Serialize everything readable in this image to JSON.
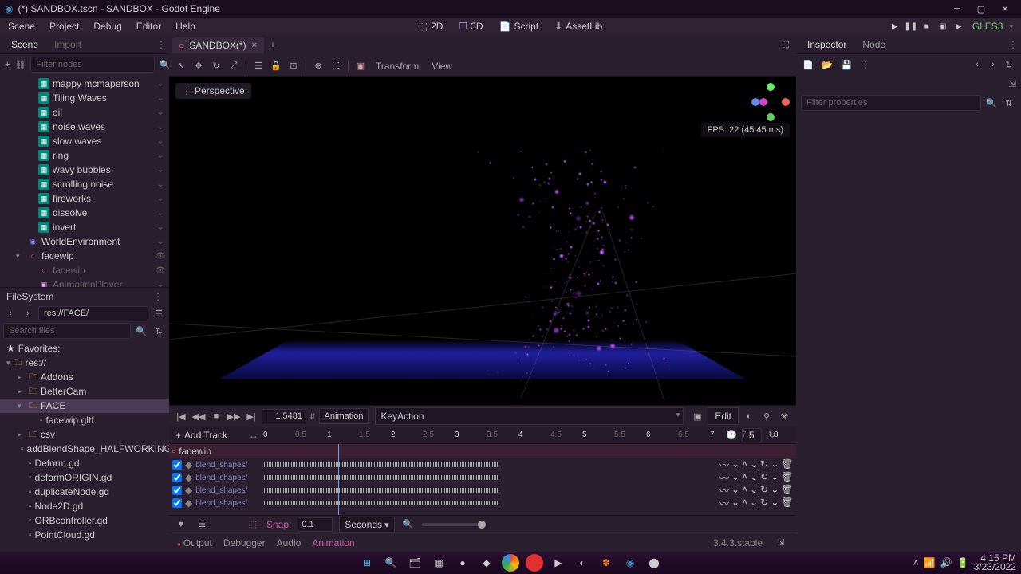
{
  "window": {
    "title": "(*) SANDBOX.tscn - SANDBOX - Godot Engine"
  },
  "menu": {
    "scene": "Scene",
    "project": "Project",
    "debug": "Debug",
    "editor": "Editor",
    "help": "Help"
  },
  "modes": {
    "d2": "2D",
    "d3": "3D",
    "script": "Script",
    "assetlib": "AssetLib"
  },
  "renderer": "GLES3",
  "scene_dock": {
    "tab_scene": "Scene",
    "tab_import": "Import",
    "filter_ph": "Filter nodes",
    "nodes": [
      {
        "name": "mappy mcmaperson",
        "type": "shader",
        "depth": 2
      },
      {
        "name": "Tiling Waves",
        "type": "shader",
        "depth": 2
      },
      {
        "name": "oil",
        "type": "shader",
        "depth": 2
      },
      {
        "name": "noise waves",
        "type": "shader",
        "depth": 2
      },
      {
        "name": "slow waves",
        "type": "shader",
        "depth": 2
      },
      {
        "name": "ring",
        "type": "shader",
        "depth": 2
      },
      {
        "name": "wavy bubbles",
        "type": "shader",
        "depth": 2
      },
      {
        "name": "scrolling noise",
        "type": "shader",
        "depth": 2
      },
      {
        "name": "fireworks",
        "type": "shader",
        "depth": 2
      },
      {
        "name": "dissolve",
        "type": "shader",
        "depth": 2
      },
      {
        "name": "invert",
        "type": "shader",
        "depth": 2
      },
      {
        "name": "WorldEnvironment",
        "type": "world",
        "depth": 1
      },
      {
        "name": "facewip",
        "type": "spatial",
        "depth": 1,
        "expanded": true,
        "extra": "eye"
      },
      {
        "name": "facewip",
        "type": "spatial",
        "depth": 2,
        "dim": true,
        "extra": "eye"
      },
      {
        "name": "AnimationPlayer",
        "type": "anim",
        "depth": 2,
        "dim": true
      }
    ]
  },
  "filesystem": {
    "title": "FileSystem",
    "path": "res://FACE/",
    "search_ph": "Search files",
    "fav": "Favorites:",
    "root": "res://",
    "items": [
      {
        "name": "Addons",
        "type": "folder",
        "depth": 1
      },
      {
        "name": "BetterCam",
        "type": "folder",
        "depth": 1
      },
      {
        "name": "FACE",
        "type": "folder",
        "depth": 1,
        "expanded": true,
        "selected": true
      },
      {
        "name": "facewip.gltf",
        "type": "file",
        "depth": 2
      },
      {
        "name": "csv",
        "type": "folder",
        "depth": 1
      },
      {
        "name": "addBlendShape_HALFWORKING.g",
        "type": "file",
        "depth": 1
      },
      {
        "name": "Deform.gd",
        "type": "file",
        "depth": 1
      },
      {
        "name": "deformORIGIN.gd",
        "type": "file",
        "depth": 1
      },
      {
        "name": "duplicateNode.gd",
        "type": "file",
        "depth": 1
      },
      {
        "name": "Node2D.gd",
        "type": "file",
        "depth": 1
      },
      {
        "name": "ORBcontroller.gd",
        "type": "file",
        "depth": 1
      },
      {
        "name": "PointCloud.gd",
        "type": "file",
        "depth": 1
      }
    ]
  },
  "scene_tab": {
    "title": "SANDBOX(*)"
  },
  "toolbar_3d": {
    "transform": "Transform",
    "view": "View",
    "perspective": "Perspective"
  },
  "viewport": {
    "fps": "FPS: 22 (45.45 ms)"
  },
  "animation": {
    "time": "1.5481",
    "anim_btn": "Animation",
    "clip": "KeyAction",
    "edit": "Edit",
    "add_track": "Add Track",
    "root": "facewip",
    "ruler": [
      "0",
      "0.5",
      "1",
      "1.5",
      "2",
      "2.5",
      "3",
      "3.5",
      "4",
      "4.5",
      "5",
      "5.5",
      "6",
      "6.5",
      "7",
      "7.5",
      "8"
    ],
    "length": "5",
    "tracks": [
      "blend_shapes/",
      "blend_shapes/",
      "blend_shapes/",
      "blend_shapes/"
    ],
    "snap_label": "Snap:",
    "snap": "0.1",
    "units": "Seconds"
  },
  "bottom": {
    "output": "Output",
    "debugger": "Debugger",
    "audio": "Audio",
    "animation": "Animation",
    "version": "3.4.3.stable"
  },
  "inspector": {
    "tab_insp": "Inspector",
    "tab_node": "Node",
    "filter_ph": "Filter properties"
  },
  "tray": {
    "time": "4:15 PM",
    "date": "3/23/2022"
  }
}
